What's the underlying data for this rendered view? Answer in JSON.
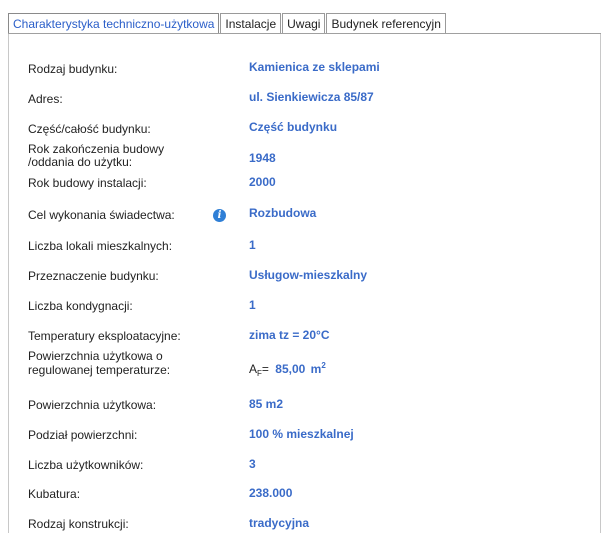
{
  "tabs": [
    {
      "label": "Charakterystyka techniczno-użytkowa",
      "active": true
    },
    {
      "label": "Instalacje",
      "active": false
    },
    {
      "label": "Uwagi",
      "active": false
    },
    {
      "label": "Budynek referencyjn",
      "active": false
    }
  ],
  "fields": {
    "rodzaj_budynku": {
      "label": "Rodzaj budynku:",
      "value": "Kamienica ze sklepami"
    },
    "adres": {
      "label": "Adres:",
      "value": "ul. Sienkiewicza 85/87"
    },
    "czesc_budynku": {
      "label": "Część/całość budynku:",
      "value": "Część budynku"
    },
    "rok_zakonczenia": {
      "label_line1": "Rok zakończenia budowy",
      "label_line2": "/oddania do użytku:",
      "value": "1948"
    },
    "rok_instalacji": {
      "label": "Rok budowy instalacji:",
      "value": "2000"
    },
    "cel_swiadectwa": {
      "label": "Cel wykonania świadectwa:",
      "info_icon_glyph": "i",
      "value": "Rozbudowa"
    },
    "liczba_lokali": {
      "label": "Liczba lokali mieszkalnych:",
      "value": "1"
    },
    "przeznaczenie": {
      "label": "Przeznaczenie budynku:",
      "value": "Usługow-mieszkalny"
    },
    "kondygnacje": {
      "label": "Liczba kondygnacji:",
      "value": "1"
    },
    "temperatury": {
      "label": "Temperatury eksploatacyjne:",
      "value": "zima tz = 20°C"
    },
    "pow_reg_temp": {
      "label_line1": "Powierzchnia użytkowa o",
      "label_line2": "regulowanej temperaturze:",
      "symbol": "A",
      "symbol_sub": "F",
      "equals": "=",
      "value": "85,00",
      "unit": "m",
      "unit_sup": "2"
    },
    "pow_uzytkowa": {
      "label": "Powierzchnia użytkowa:",
      "value": "85 m2"
    },
    "podzial": {
      "label": "Podział powierzchni:",
      "value": "100 % mieszkalnej"
    },
    "uzytkownicy": {
      "label": "Liczba użytkowników:",
      "value": "3"
    },
    "kubatura": {
      "label": "Kubatura:",
      "value": "238.000"
    },
    "konstrukcja": {
      "label": "Rodzaj konstrukcji:",
      "value": "tradycyjna"
    }
  }
}
